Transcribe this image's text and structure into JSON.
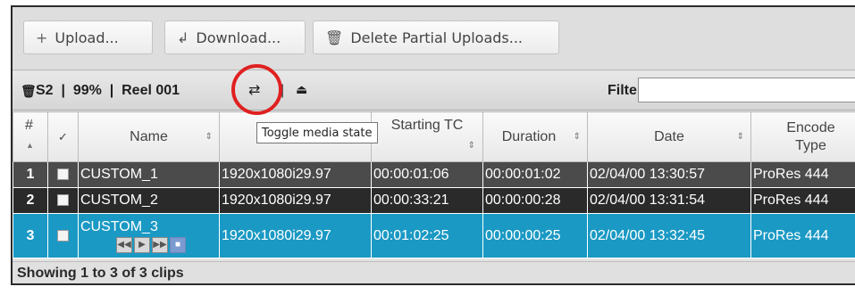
{
  "toolbar": {
    "upload": {
      "icon": "plus-icon",
      "glyph": "+",
      "label": "Upload..."
    },
    "download": {
      "icon": "return-arrow-icon",
      "glyph": "↲",
      "label": "Download..."
    },
    "delete": {
      "icon": "trash-icon",
      "glyph": "🗑",
      "label": "Delete Partial Uploads..."
    }
  },
  "status": {
    "trash_glyph": "🗑",
    "info": "S2  |  99%  |  Reel 001",
    "sep": "|",
    "toggle_glyph": "⇄",
    "eject_glyph": "⏏",
    "filter_label": "Filter:",
    "filter_value": ""
  },
  "table": {
    "headers": {
      "num": "#",
      "check": "✓",
      "name": "Name",
      "format": "",
      "starting_tc": "Starting TC",
      "duration": "Duration",
      "date": "Date",
      "encode_type": "Encode Type"
    },
    "sort_glyph": "⇕",
    "rows": [
      {
        "num": "1",
        "name": "CUSTOM_1",
        "format": "1920x1080i29.97",
        "starting_tc": "00:00:01:06",
        "duration": "00:00:01:02",
        "date": "02/04/00 13:30:57",
        "encode": "ProRes 444"
      },
      {
        "num": "2",
        "name": "CUSTOM_2",
        "format": "1920x1080i29.97",
        "starting_tc": "00:00:33:21",
        "duration": "00:00:00:28",
        "date": "02/04/00 13:31:54",
        "encode": "ProRes 444"
      },
      {
        "num": "3",
        "name": "CUSTOM_3",
        "format": "1920x1080i29.97",
        "starting_tc": "00:01:02:25",
        "duration": "00:00:00:25",
        "date": "02/04/00 13:32:45",
        "encode": "ProRes 444"
      }
    ],
    "transport": {
      "rewind": "◀◀",
      "play": "▶",
      "forward": "▶▶",
      "stop": "■"
    }
  },
  "tooltip": "Toggle media state",
  "footer": "Showing 1 to 3 of 3 clips",
  "colors": {
    "selected_row": "#1a99c4",
    "highlight_circle": "#e02020"
  }
}
